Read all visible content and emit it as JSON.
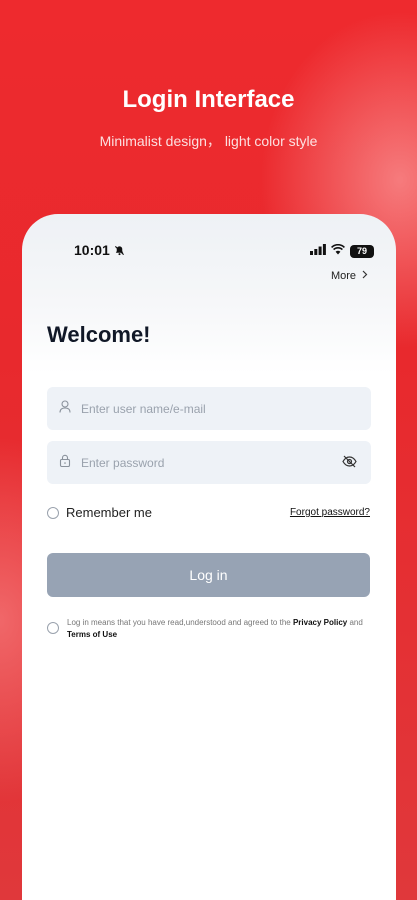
{
  "hero": {
    "title": "Login Interface",
    "subtitle": "Minimalist design， light color style"
  },
  "status_bar": {
    "time": "10:01",
    "battery": "79",
    "icons": [
      "bell-off-icon",
      "signal-icon",
      "wifi-icon",
      "battery-icon"
    ]
  },
  "header": {
    "more_label": "More"
  },
  "form": {
    "welcome": "Welcome!",
    "username_placeholder": "Enter user name/e-mail",
    "username_value": "",
    "password_placeholder": "Enter password",
    "password_value": "",
    "remember_label": "Remember me",
    "remember_checked": false,
    "forgot_label": "Forgot password?",
    "login_label": "Log in"
  },
  "agreement": {
    "prefix": "Log in means that you have read,understood and agreed to the ",
    "privacy": "Privacy Policy",
    "and": " and ",
    "terms": "Terms of Use",
    "checked": false
  },
  "colors": {
    "brand_red": "#e92a2e",
    "button_disabled": "#97a3b4",
    "input_bg": "#eef2f7"
  }
}
